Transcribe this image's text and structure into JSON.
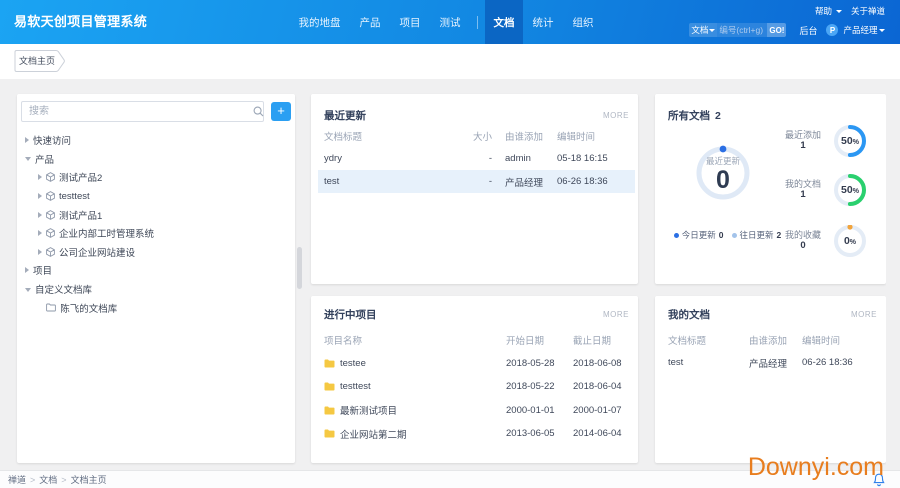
{
  "topbar": {
    "brand": "易软天创项目管理系统",
    "nav": [
      {
        "label": "我的地盘"
      },
      {
        "label": "产品"
      },
      {
        "label": "项目"
      },
      {
        "label": "测试"
      },
      {
        "label": "文档",
        "active": true
      },
      {
        "label": "统计"
      },
      {
        "label": "组织"
      }
    ],
    "help_label": "帮助",
    "about_label": "关于禅道",
    "search_scope": "文档",
    "search_placeholder": "编号(ctrl+g)",
    "go_label": "GO!",
    "admin_label": "后台",
    "avatar_initial": "P",
    "user_name": "产品经理"
  },
  "tab": {
    "label": "文档主页"
  },
  "sidebar": {
    "search_placeholder": "搜索",
    "add_button_label": "+",
    "tree": [
      {
        "label": "快速访问",
        "level": 0,
        "caret": "right",
        "icon": "none"
      },
      {
        "label": "产品",
        "level": 0,
        "caret": "down",
        "icon": "none"
      },
      {
        "label": "测试产品2",
        "level": 1,
        "caret": "right",
        "icon": "cube"
      },
      {
        "label": "testtest",
        "level": 1,
        "caret": "right",
        "icon": "cube"
      },
      {
        "label": "测试产品1",
        "level": 1,
        "caret": "right",
        "icon": "cube"
      },
      {
        "label": "企业内部工时管理系统",
        "level": 1,
        "caret": "right",
        "icon": "cube"
      },
      {
        "label": "公司企业网站建设",
        "level": 1,
        "caret": "right",
        "icon": "cube"
      },
      {
        "label": "项目",
        "level": 0,
        "caret": "right",
        "icon": "none"
      },
      {
        "label": "自定义文档库",
        "level": 0,
        "caret": "down",
        "icon": "none"
      },
      {
        "label": "陈飞的文档库",
        "level": 1,
        "caret": "none",
        "icon": "folder-outline"
      }
    ]
  },
  "cards": {
    "recent": {
      "title": "最近更新",
      "more": "MORE",
      "headers": [
        "文档标题",
        "大小",
        "由谁添加",
        "编辑时间"
      ],
      "rows": [
        {
          "title": "ydry",
          "size": "-",
          "adder": "admin",
          "time": "05-18 16:15",
          "highlight": false
        },
        {
          "title": "test",
          "size": "-",
          "adder": "产品经理",
          "time": "06-26 18:36",
          "highlight": true
        }
      ]
    },
    "all_docs": {
      "title": "所有文档",
      "count": "2",
      "donut": {
        "label": "最近更新",
        "value": "0",
        "percent": 0,
        "ring_color": "#dfe9f6",
        "dot_color": "#2b6fe4"
      },
      "legend": [
        {
          "label": "今日更新",
          "value": "0",
          "color": "#2b6fe4"
        },
        {
          "label": "往日更新",
          "value": "2",
          "color": "#a3c3ea"
        }
      ],
      "stats": [
        {
          "label": "最近添加",
          "value": "1",
          "percent": 50,
          "pct_num": "50",
          "pct_sign": "%",
          "color": "#2b97f3",
          "ring_color": "#e4ecf6"
        },
        {
          "label": "我的文档",
          "value": "1",
          "percent": 50,
          "pct_num": "50",
          "pct_sign": "%",
          "color": "#2ad06e",
          "ring_color": "#e4ecf6"
        },
        {
          "label": "我的收藏",
          "value": "0",
          "percent": 0,
          "pct_num": "0",
          "pct_sign": "%",
          "color": "#f2a43c",
          "ring_color": "#e4ecf6"
        }
      ]
    },
    "projects": {
      "title": "进行中项目",
      "more": "MORE",
      "headers": [
        "项目名称",
        "开始日期",
        "截止日期"
      ],
      "rows": [
        {
          "name": "testee",
          "start": "2018-05-28",
          "end": "2018-06-08"
        },
        {
          "name": "testtest",
          "start": "2018-05-22",
          "end": "2018-06-04"
        },
        {
          "name": "最新测试项目",
          "start": "2000-01-01",
          "end": "2000-01-07"
        },
        {
          "name": "企业网站第二期",
          "start": "2013-06-05",
          "end": "2014-06-04"
        }
      ]
    },
    "my_docs": {
      "title": "我的文档",
      "more": "MORE",
      "headers": [
        "文档标题",
        "由谁添加",
        "编辑时间"
      ],
      "rows": [
        {
          "title": "test",
          "adder": "产品经理",
          "time": "06-26 18:36"
        }
      ]
    }
  },
  "footer": {
    "breadcrumb": [
      "禅道",
      "文档",
      "文档主页"
    ],
    "separator": ">"
  },
  "watermark": "Downyi.com",
  "colors": {
    "topbar_gradient_start": "#1ba4f3",
    "topbar_gradient_end": "#0b66d3",
    "nav_active_bg": "#0b66c4",
    "accent_blue": "#2b9ff2",
    "highlight_row": "#e7f1fb",
    "folder_yellow": "#f5c842",
    "watermark_orange": "#e87d1e"
  }
}
